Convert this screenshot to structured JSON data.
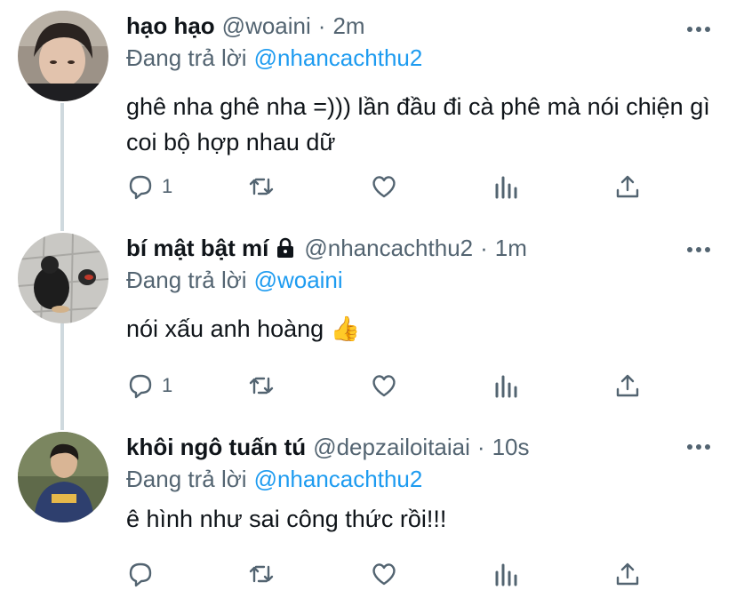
{
  "tweets": [
    {
      "name": "hạo hạo",
      "handle": "@woaini",
      "separator": "·",
      "time": "2m",
      "reply_prefix": "Đang trả lời",
      "reply_to": "@nhancachthu2",
      "text": "ghê nha ghê nha =))) lần đầu đi cà phê mà nói chiện gì coi bộ hợp nhau dữ",
      "reply_count": "1",
      "locked": false
    },
    {
      "name": "bí mật bật mí",
      "handle": "@nhancachthu2",
      "separator": "·",
      "time": "1m",
      "reply_prefix": "Đang trả lời",
      "reply_to": "@woaini",
      "text": "nói xấu anh hoàng 👍",
      "reply_count": "1",
      "locked": true
    },
    {
      "name": "khôi ngô tuấn tú",
      "handle": "@depzailoitaiai",
      "separator": "·",
      "time": "10s",
      "reply_prefix": "Đang trả lời",
      "reply_to": "@nhancachthu2",
      "text": "ê hình như sai công thức rồi!!!",
      "reply_count": "",
      "locked": false
    }
  ],
  "icons": {
    "more": "more-horizontal-icon",
    "reply": "reply-bubble-icon",
    "retweet": "retweet-icon",
    "like": "heart-icon",
    "analytics": "analytics-icon",
    "share": "share-icon",
    "lock": "lock-icon"
  },
  "colors": {
    "text": "#0f1419",
    "secondary": "#536471",
    "link": "#1d9bf0",
    "thread_line": "#cfd9de"
  }
}
